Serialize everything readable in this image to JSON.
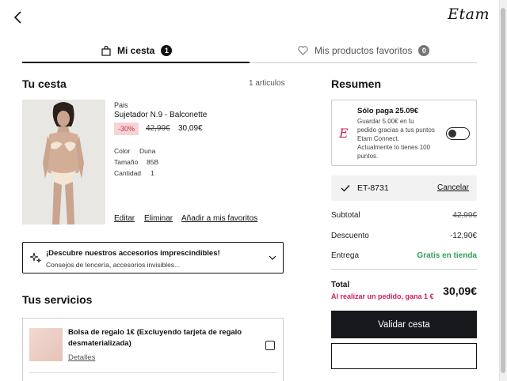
{
  "header": {
    "logo": "Etam"
  },
  "tabs": {
    "cart": {
      "label": "Mi cesta",
      "count": "1"
    },
    "favorites": {
      "label": "Mis productos favoritos",
      "count": "0"
    }
  },
  "cart": {
    "title": "Tu cesta",
    "count_text": "1 articulos",
    "item": {
      "category": "Pais",
      "name": "Sujetador N.9 - Balconette",
      "discount": "-30%",
      "old_price": "42,99€",
      "price": "30,09€",
      "color_label": "Color",
      "color_value": "Duna",
      "size_label": "Tamaño",
      "size_value": "85B",
      "qty_label": "Cantidad",
      "qty_value": "1",
      "edit": "Editar",
      "remove": "Eliminar",
      "add_fav": "Añadir a mis favoritos"
    }
  },
  "accessories": {
    "title": "¡Descubre nuestros accesorios imprescindibles!",
    "subtitle": "Consejos de lencería, accesorios invisibles..."
  },
  "services": {
    "title": "Tus servicios",
    "item": {
      "name_line1": "Bolsa de regalo 1€ (Excluyendo tarjeta de regalo",
      "name_line2": "desmaterializada)",
      "details": "Detalles"
    }
  },
  "summary": {
    "title": "Resumen",
    "loyalty": {
      "title": "Sólo paga 25.09€",
      "line1": "Guardar 5.00€ en tu",
      "line2": "pedido gracias a tus puntos",
      "line3": "Etam Connect.",
      "line4": "Actualmente lo tienes 100",
      "line5": "puntos.",
      "enabled": false
    },
    "promo": {
      "code": "ET-8731",
      "cancel": "Cancelar"
    },
    "subtotal_label": "Subtotal",
    "subtotal_value": "42,99€",
    "discount_label": "Descuento",
    "discount_value": "-12,90€",
    "delivery_label": "Entrega",
    "delivery_value": "Gratis en tienda",
    "total_label": "Total",
    "total_note": "Al realizar un pedido, gana 1 €",
    "total_value": "30,09€",
    "checkout": "Validar cesta"
  },
  "colors": {
    "accent": "#d11f5a",
    "dark": "#16181c",
    "success": "#2ea44f",
    "discount_bg": "#f7d4d4"
  }
}
